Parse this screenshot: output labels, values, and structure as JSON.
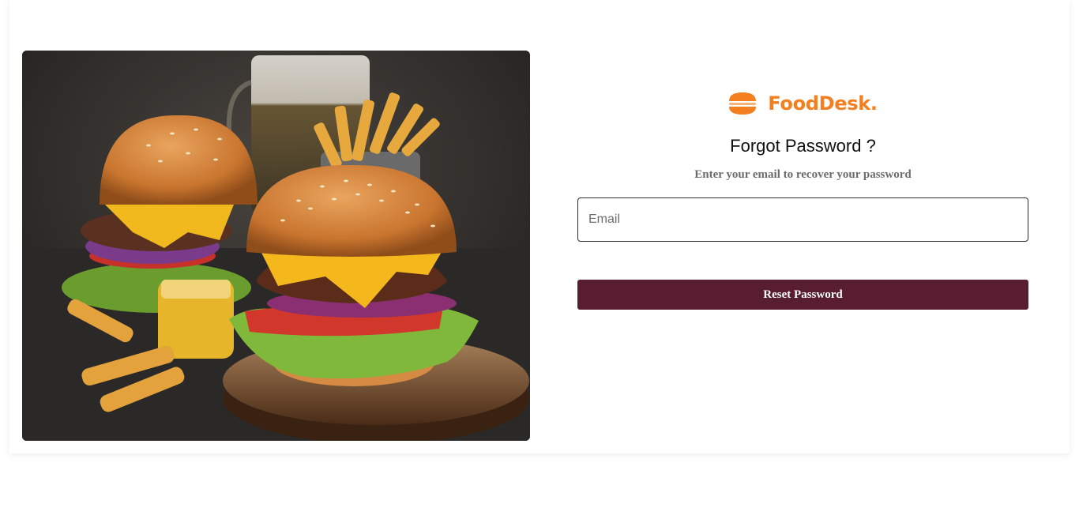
{
  "hero": {
    "image": "burger-photo"
  },
  "brand": {
    "name": "FoodDesk.",
    "icon": "burger-icon",
    "color": "#f47f20"
  },
  "form": {
    "title": "Forgot Password ?",
    "subtitle": "Enter your email to recover your password",
    "email_placeholder": "Email",
    "email_value": "",
    "submit_label": "Reset Password",
    "submit_color": "#581d31"
  }
}
